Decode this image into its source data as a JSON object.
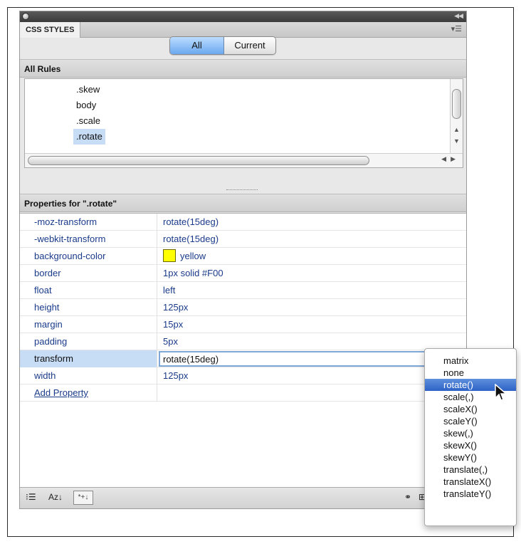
{
  "panel": {
    "tab_label": "CSS STYLES",
    "panel_menu_icon": "menu-icon",
    "collapse_icon": "collapse-icon"
  },
  "mode": {
    "all_label": "All",
    "current_label": "Current",
    "selected": "All"
  },
  "all_rules": {
    "header": "All Rules",
    "rules": [
      ".skew",
      "body",
      ".scale",
      ".rotate"
    ],
    "selected_rule": ".rotate"
  },
  "properties": {
    "header": "Properties for \".rotate\"",
    "rows": [
      {
        "name": "-moz-transform",
        "value": "rotate(15deg)"
      },
      {
        "name": "-webkit-transform",
        "value": "rotate(15deg)"
      },
      {
        "name": "background-color",
        "value": "yellow",
        "swatch": "#FFFF00"
      },
      {
        "name": "border",
        "value": "1px solid #F00"
      },
      {
        "name": "float",
        "value": "left"
      },
      {
        "name": "height",
        "value": "125px"
      },
      {
        "name": "margin",
        "value": "15px"
      },
      {
        "name": "padding",
        "value": "5px"
      },
      {
        "name": "transform",
        "value": "rotate(15deg)",
        "editing": true
      },
      {
        "name": "width",
        "value": "125px"
      }
    ],
    "add_property_label": "Add Property"
  },
  "autocomplete": {
    "options": [
      "matrix",
      "none",
      "rotate()",
      "scale(,)",
      "scaleX()",
      "scaleY()",
      "skew(,)",
      "skewX()",
      "skewY()",
      "translate(,)",
      "translateX()",
      "translateY()"
    ],
    "highlighted": "rotate()"
  },
  "toolbar": {
    "left_icons": [
      "category-view-icon",
      "alphabetical-view-icon",
      "set-properties-view-icon"
    ],
    "alpha_label": "Az↓",
    "set_props_label": "*+↓",
    "right_icons": [
      "attach-stylesheet-icon",
      "new-rule-icon",
      "edit-rule-icon",
      "disable-property-icon"
    ]
  },
  "colors": {
    "selection": "#C7DCF5",
    "highlight": "#2E63C7",
    "link": "#1A3B8A"
  }
}
